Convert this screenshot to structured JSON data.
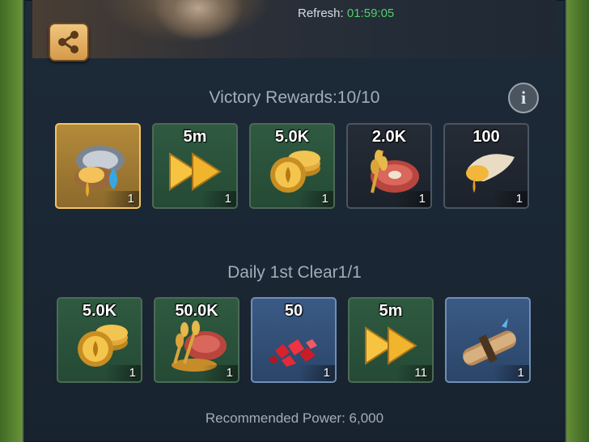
{
  "header": {
    "refresh_label": "Refresh:",
    "refresh_time": "01:59:05",
    "share_icon": "share-icon"
  },
  "victory": {
    "title": "Victory Rewards:10/10",
    "info_icon": "info-icon",
    "rewards": [
      {
        "icon": "honey-shell-icon",
        "amount": "",
        "count": "1",
        "frame": "gold"
      },
      {
        "icon": "speedup-arrows-icon",
        "amount": "5m",
        "count": "1",
        "frame": "green"
      },
      {
        "icon": "gold-coins-icon",
        "amount": "5.0K",
        "count": "1",
        "frame": "green"
      },
      {
        "icon": "food-meat-wheat-icon",
        "amount": "2.0K",
        "count": "1",
        "frame": "dark"
      },
      {
        "icon": "honey-horn-icon",
        "amount": "100",
        "count": "1",
        "frame": "dark"
      }
    ]
  },
  "daily": {
    "title": "Daily 1st Clear1/1",
    "rewards": [
      {
        "icon": "gold-coins-icon",
        "amount": "5.0K",
        "count": "1",
        "frame": "green"
      },
      {
        "icon": "food-meat-wheat-icon",
        "amount": "50.0K",
        "count": "1",
        "frame": "green"
      },
      {
        "icon": "red-gems-icon",
        "amount": "50",
        "count": "1",
        "frame": "blue"
      },
      {
        "icon": "speedup-arrows-icon",
        "amount": "5m",
        "count": "11",
        "frame": "green"
      },
      {
        "icon": "scroll-icon",
        "amount": "",
        "count": "1",
        "frame": "blue"
      }
    ]
  },
  "footer": {
    "power_text": "Recommended Power: 6,000"
  },
  "colors": {
    "timer_green": "#4fd06a",
    "gold_frame": "#f2c565"
  }
}
